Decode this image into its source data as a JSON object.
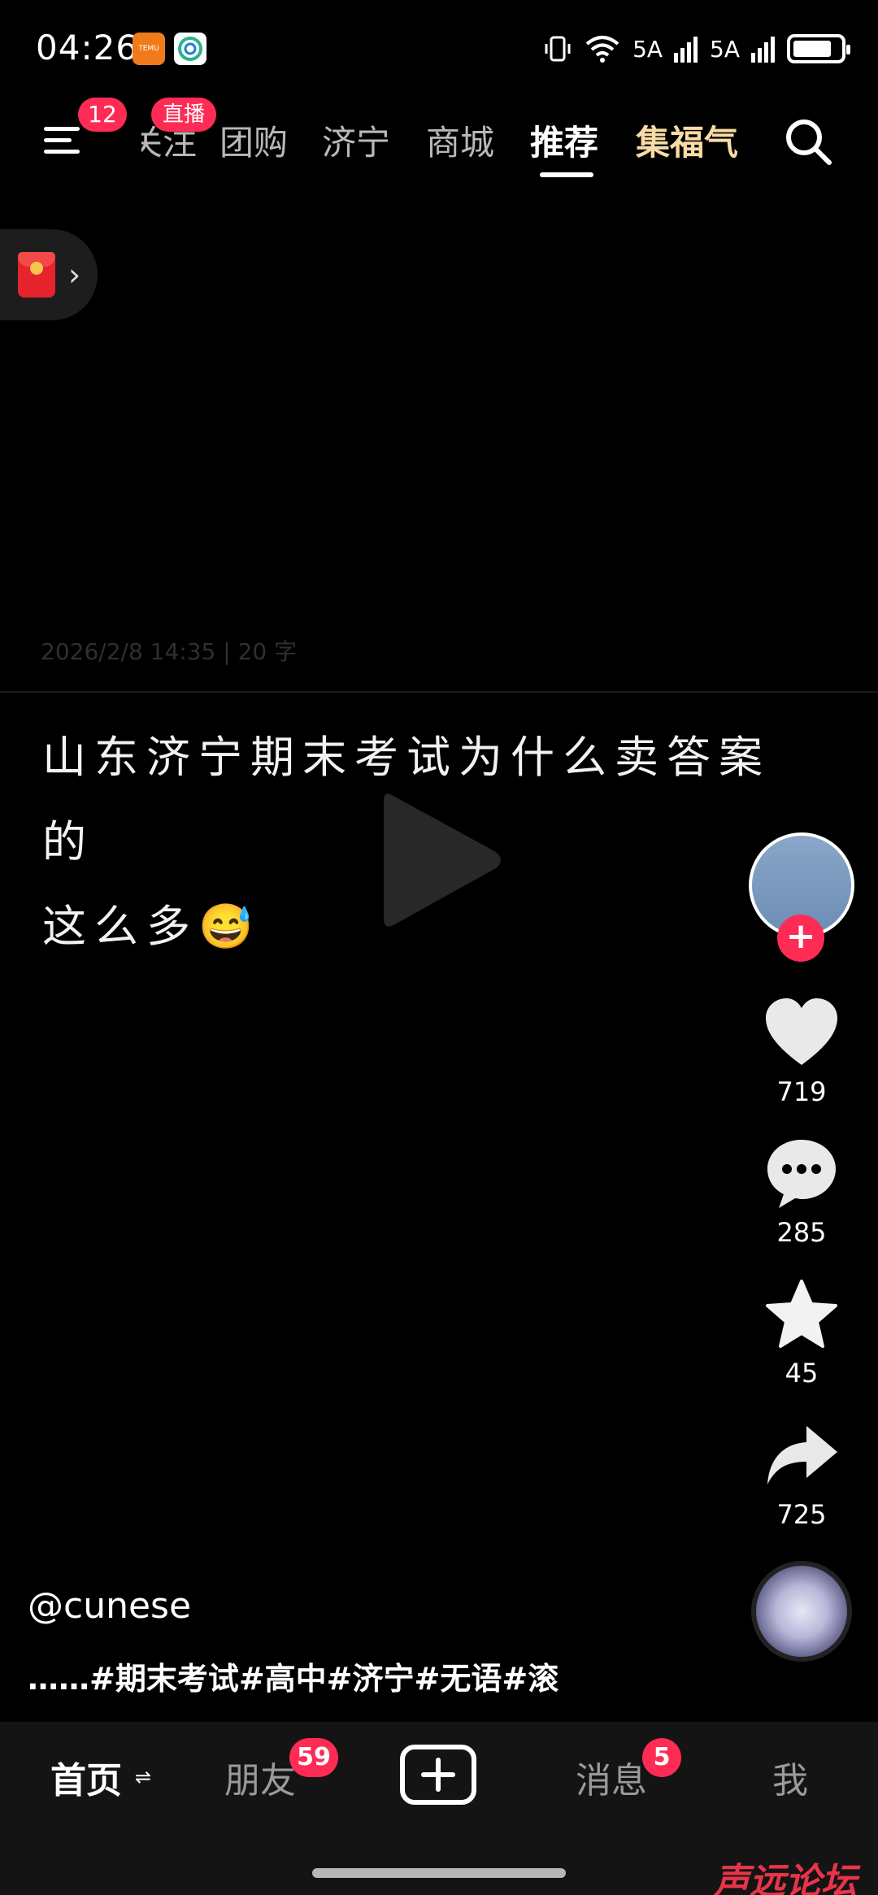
{
  "status_bar": {
    "time": "04:26",
    "apps": [
      "temu-icon",
      "china-mobile-icon"
    ],
    "signal_1": "5A",
    "signal_2": "5A",
    "wifi": "6"
  },
  "top_nav": {
    "menu_badge": "12",
    "live_badge": "直播",
    "tabs": [
      {
        "label": "关注",
        "state": "partial"
      },
      {
        "label": "团购"
      },
      {
        "label": "济宁"
      },
      {
        "label": "商城"
      },
      {
        "label": "推荐",
        "state": "active"
      },
      {
        "label": "集福气",
        "state": "gold"
      }
    ]
  },
  "post": {
    "meta_faint": "2026/2/8 14:35 | 20 字",
    "caption_line1": "山东济宁期末考试为什么卖答案的",
    "caption_line2": "这么多😅",
    "author": "@cunese",
    "hashtags": "……#期末考试#高中#济宁#无语#滚"
  },
  "actions": {
    "likes": "719",
    "comments": "285",
    "favorites": "45",
    "shares": "725"
  },
  "bottom_nav": {
    "home": "首页",
    "home_switch": "⇌",
    "friends": "朋友",
    "friends_badge": "59",
    "messages": "消息",
    "messages_badge": "5",
    "me": "我"
  },
  "watermark": "声远论坛",
  "colors": {
    "accent": "#fe2c55",
    "gold_tab": "#f8dca5",
    "background": "#000000"
  }
}
